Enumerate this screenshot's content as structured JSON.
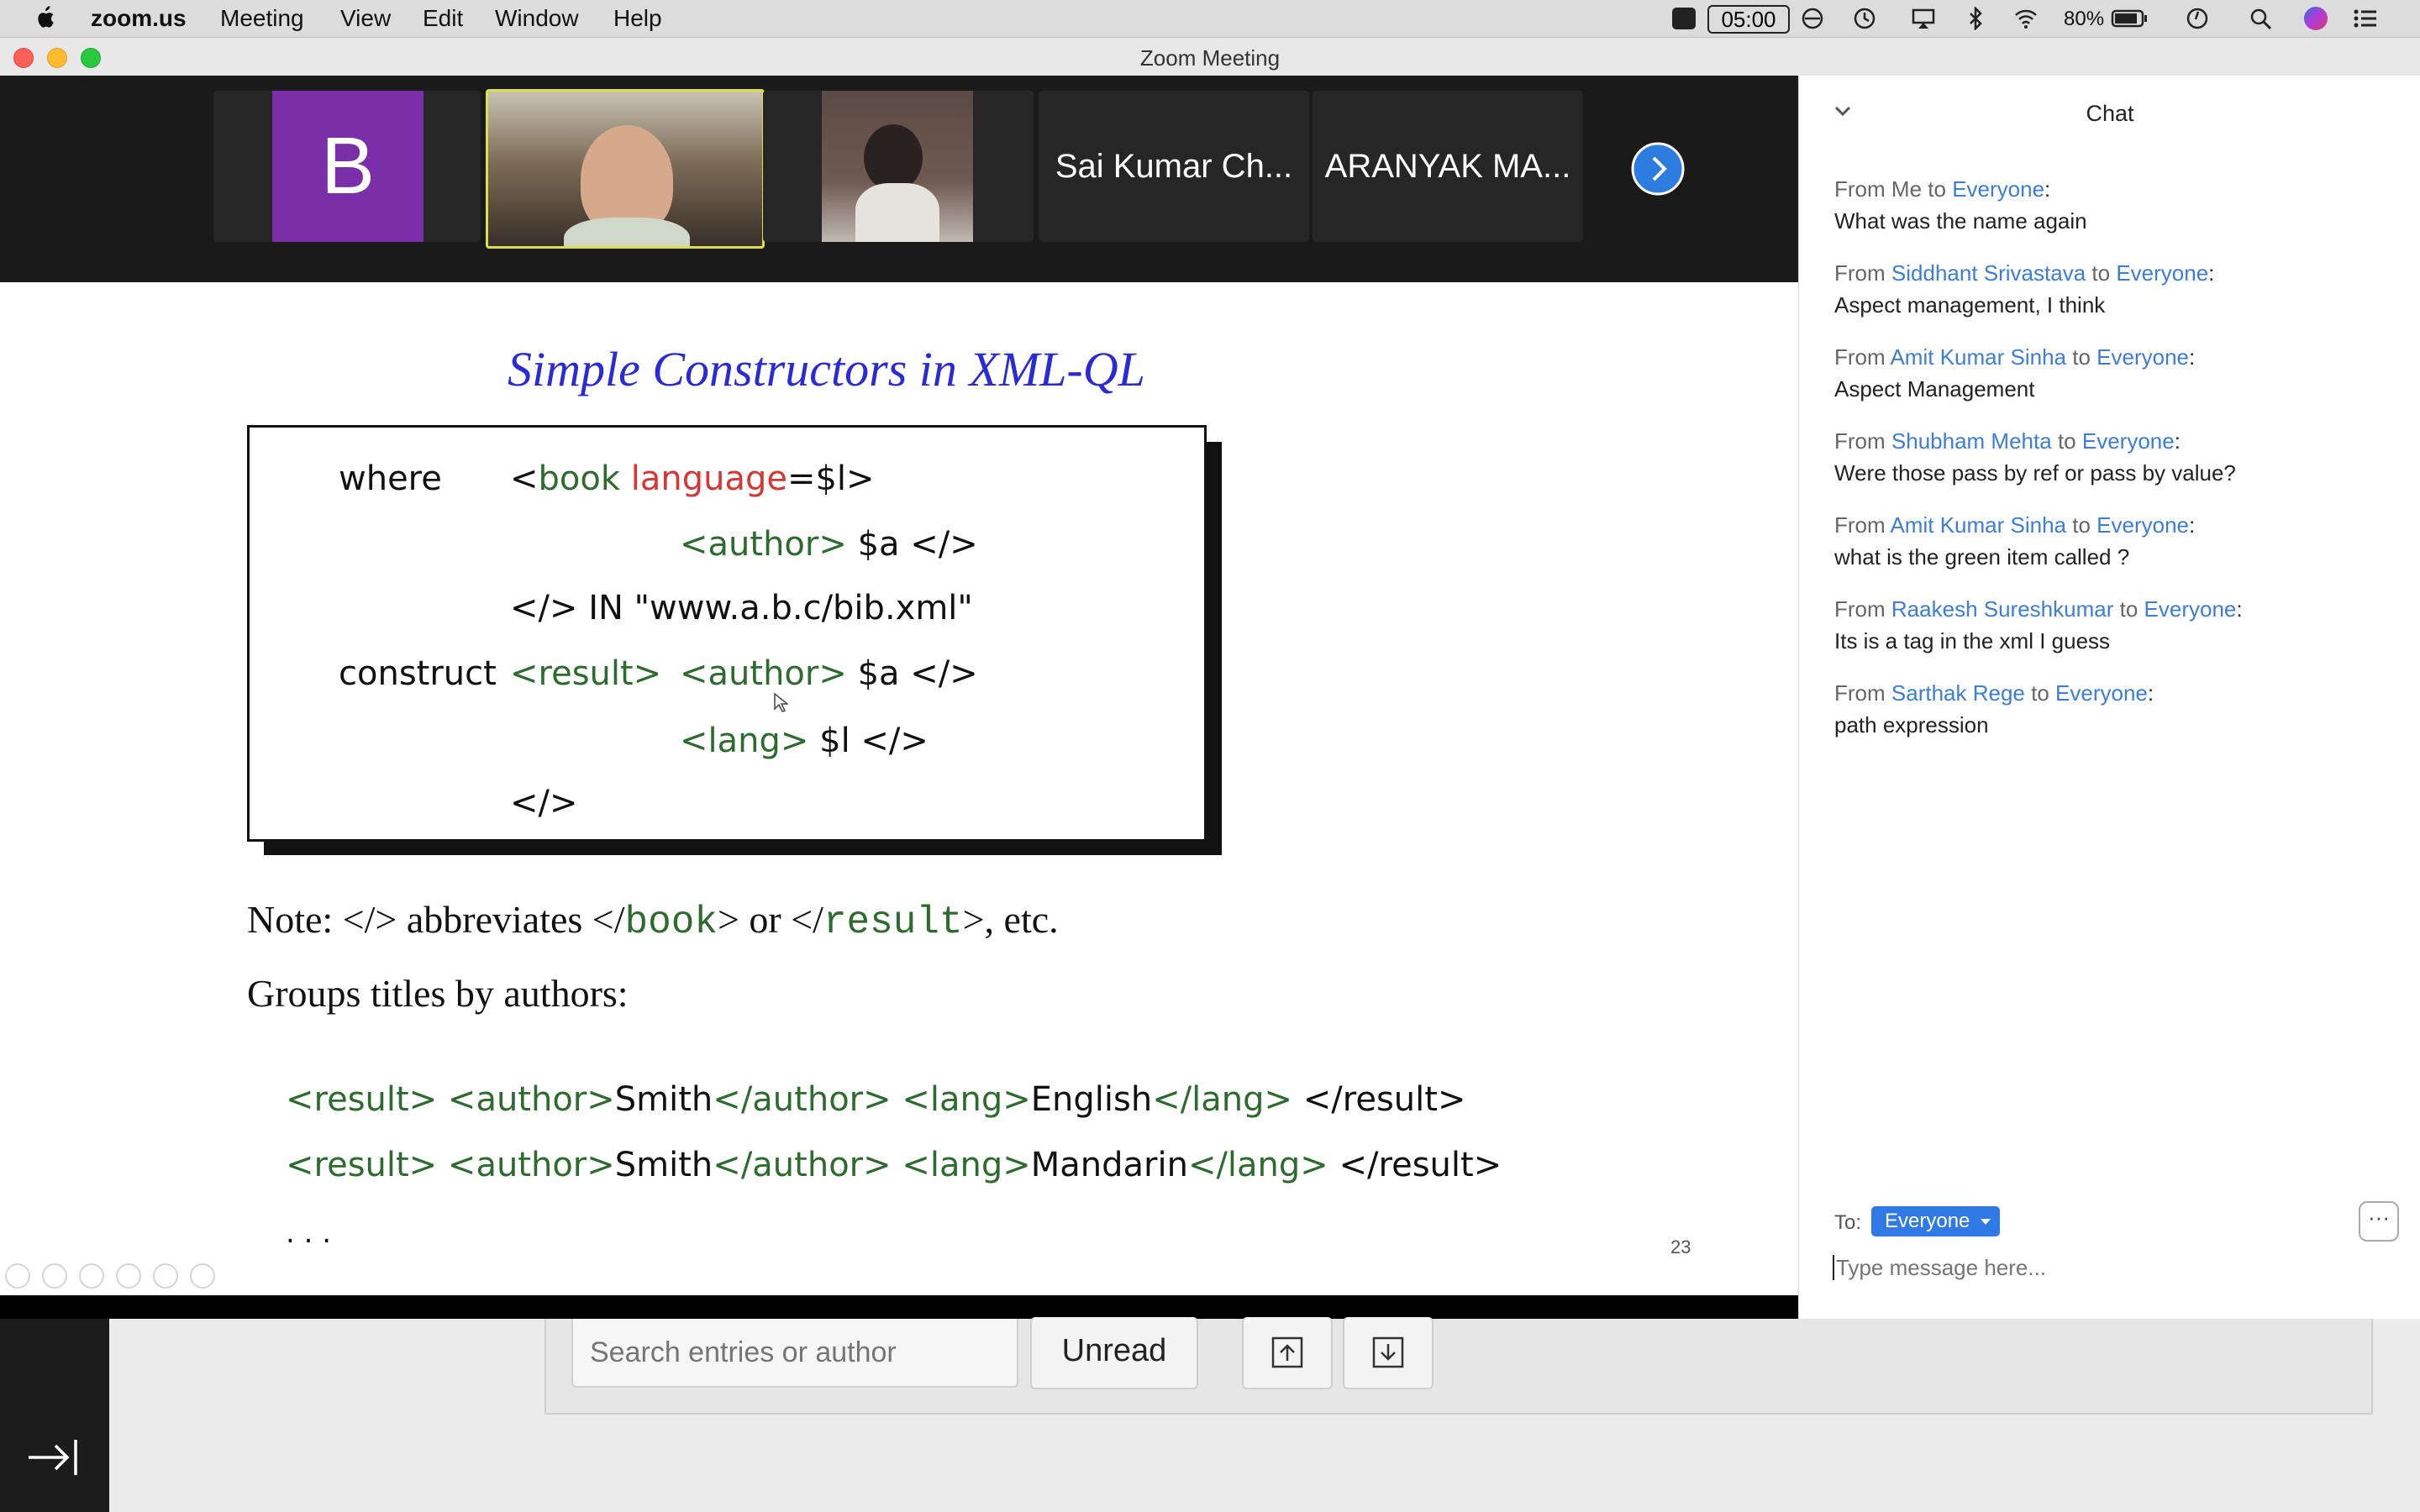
{
  "menubar": {
    "app": "zoom.us",
    "items": [
      "Meeting",
      "View",
      "Edit",
      "Window",
      "Help"
    ],
    "timer": "05:00",
    "battery": "80%"
  },
  "window": {
    "title": "Zoom Meeting"
  },
  "participants": {
    "avatar_letter": "B",
    "names": [
      "Sai Kumar Ch...",
      "ARANYAK MA..."
    ]
  },
  "slide": {
    "title": "Simple Constructors in XML-QL",
    "where_kw": "where",
    "construct_kw": "construct",
    "line1_open": "<",
    "line1_tag": "book",
    "line1_attr": "language",
    "line1_rest": "=$l>",
    "line2": "$a </>",
    "line2_tag": "<author>",
    "line3": "</> IN \"www.a.b.c/bib.xml\"",
    "line4_result": "<result>",
    "line4_author": "<author>",
    "line4_rest": "$a </>",
    "line5_tag": "<lang>",
    "line5_rest": "$l </>",
    "line6": "</>",
    "note_prefix": "Note: </> abbreviates </",
    "note_book": "book",
    "note_mid": "> or </",
    "note_result": "result",
    "note_suffix": ">, etc.",
    "groups": "Groups titles by authors:",
    "out1_result": "<result>",
    "out1_author": "<author>",
    "out1_smith": "Smith",
    "out1_close_author": "</author>",
    "out1_lang": "<lang>",
    "out1_val": "English",
    "out1_close_lang": "</lang>",
    "out1_close_result": "</result>",
    "out2_result": "<result>",
    "out2_author": "<author>",
    "out2_smith": "Smith",
    "out2_close_author": "</author>",
    "out2_lang": "<lang>",
    "out2_val": "Mandarin",
    "out2_close_lang": "</lang>",
    "out2_close_result": "</result>",
    "ellipsis": ". . .",
    "page": "23"
  },
  "chat": {
    "title": "Chat",
    "from_word": "From",
    "to_word": "to",
    "messages": [
      {
        "from": "Me",
        "to": "Everyone",
        "text": "What was the name again"
      },
      {
        "from": "Siddhant Srivastava",
        "to": "Everyone",
        "text": "Aspect management, I think"
      },
      {
        "from": "Amit Kumar Sinha",
        "to": "Everyone",
        "text": "Aspect Management"
      },
      {
        "from": "Shubham Mehta",
        "to": "Everyone",
        "text": "Were those pass by ref or pass by value?"
      },
      {
        "from": "Amit Kumar Sinha",
        "to": "Everyone",
        "text": "what is the green item called ?"
      },
      {
        "from": "Raakesh Sureshkumar",
        "to": "Everyone",
        "text": "Its is a tag in the xml I guess"
      },
      {
        "from": "Sarthak Rege",
        "to": "Everyone",
        "text": "path expression"
      }
    ],
    "to_label": "To:",
    "recipient": "Everyone",
    "placeholder": "Type message here..."
  },
  "reader": {
    "search_placeholder": "Search entries or author",
    "unread_label": "Unread"
  },
  "colors": {
    "accent": "#3b7dd8",
    "tag_green": "#2e6b2e",
    "attr_red": "#d33",
    "avatar_purple": "#7a2ea8",
    "title_blue": "#2a2ad8"
  }
}
